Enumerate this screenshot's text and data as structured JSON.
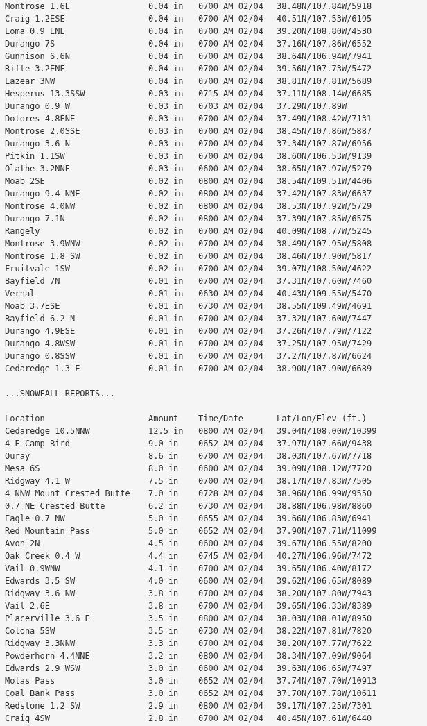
{
  "precip_rows": [
    {
      "location": "Montrose 1.6E",
      "amount": "0.04 in",
      "time": "0700 AM 02/04",
      "latlon": "38.48N/107.84W/5918"
    },
    {
      "location": "Craig 1.2ESE",
      "amount": "0.04 in",
      "time": "0700 AM 02/04",
      "latlon": "40.51N/107.53W/6195"
    },
    {
      "location": "Loma 0.9 ENE",
      "amount": "0.04 in",
      "time": "0700 AM 02/04",
      "latlon": "39.20N/108.80W/4530"
    },
    {
      "location": "Durango 7S",
      "amount": "0.04 in",
      "time": "0700 AM 02/04",
      "latlon": "37.16N/107.86W/6552"
    },
    {
      "location": "Gunnison 6.6N",
      "amount": "0.04 in",
      "time": "0700 AM 02/04",
      "latlon": "38.64N/106.94W/7941"
    },
    {
      "location": "Rifle 3.2ENE",
      "amount": "0.04 in",
      "time": "0700 AM 02/04",
      "latlon": "39.56N/107.73W/5472"
    },
    {
      "location": "Lazear 3NW",
      "amount": "0.04 in",
      "time": "0700 AM 02/04",
      "latlon": "38.81N/107.81W/5689"
    },
    {
      "location": "Hesperus 13.3SSW",
      "amount": "0.03 in",
      "time": "0715 AM 02/04",
      "latlon": "37.11N/108.14W/6685"
    },
    {
      "location": "Durango 0.9 W",
      "amount": "0.03 in",
      "time": "0703 AM 02/04",
      "latlon": "37.29N/107.89W"
    },
    {
      "location": "Dolores 4.8ENE",
      "amount": "0.03 in",
      "time": "0700 AM 02/04",
      "latlon": "37.49N/108.42W/7131"
    },
    {
      "location": "Montrose 2.0SSE",
      "amount": "0.03 in",
      "time": "0700 AM 02/04",
      "latlon": "38.45N/107.86W/5887"
    },
    {
      "location": "Durango 3.6 N",
      "amount": "0.03 in",
      "time": "0700 AM 02/04",
      "latlon": "37.34N/107.87W/6956"
    },
    {
      "location": "Pitkin 1.1SW",
      "amount": "0.03 in",
      "time": "0700 AM 02/04",
      "latlon": "38.60N/106.53W/9139"
    },
    {
      "location": "Olathe 3.2NNE",
      "amount": "0.03 in",
      "time": "0600 AM 02/04",
      "latlon": "38.65N/107.97W/5279"
    },
    {
      "location": "Moab 2SE",
      "amount": "0.02 in",
      "time": "0800 AM 02/04",
      "latlon": "38.54N/109.51W/4406"
    },
    {
      "location": "Durango 9.4 NNE",
      "amount": "0.02 in",
      "time": "0800 AM 02/04",
      "latlon": "37.42N/107.83W/6637"
    },
    {
      "location": "Montrose 4.0NW",
      "amount": "0.02 in",
      "time": "0800 AM 02/04",
      "latlon": "38.53N/107.92W/5729"
    },
    {
      "location": "Durango 7.1N",
      "amount": "0.02 in",
      "time": "0800 AM 02/04",
      "latlon": "37.39N/107.85W/6575"
    },
    {
      "location": "Rangely",
      "amount": "0.02 in",
      "time": "0700 AM 02/04",
      "latlon": "40.09N/108.77W/5245"
    },
    {
      "location": "Montrose 3.9WNW",
      "amount": "0.02 in",
      "time": "0700 AM 02/04",
      "latlon": "38.49N/107.95W/5808"
    },
    {
      "location": "Montrose 1.8 SW",
      "amount": "0.02 in",
      "time": "0700 AM 02/04",
      "latlon": "38.46N/107.90W/5817"
    },
    {
      "location": "Fruitvale 1SW",
      "amount": "0.02 in",
      "time": "0700 AM 02/04",
      "latlon": "39.07N/108.50W/4622"
    },
    {
      "location": "Bayfield 7N",
      "amount": "0.01 in",
      "time": "0700 AM 02/04",
      "latlon": "37.31N/107.60W/7460"
    },
    {
      "location": "Vernal",
      "amount": "0.01 in",
      "time": "0630 AM 02/04",
      "latlon": "40.43N/109.55W/5470"
    },
    {
      "location": "Moab 3.7ESE",
      "amount": "0.01 in",
      "time": "0730 AM 02/04",
      "latlon": "38.55N/109.49W/4691"
    },
    {
      "location": "Bayfield 6.2 N",
      "amount": "0.01 in",
      "time": "0700 AM 02/04",
      "latlon": "37.32N/107.60W/7447"
    },
    {
      "location": "Durango 4.9ESE",
      "amount": "0.01 in",
      "time": "0700 AM 02/04",
      "latlon": "37.26N/107.79W/7122"
    },
    {
      "location": "Durango 4.8WSW",
      "amount": "0.01 in",
      "time": "0700 AM 02/04",
      "latlon": "37.25N/107.95W/7429"
    },
    {
      "location": "Durango 0.8SSW",
      "amount": "0.01 in",
      "time": "0700 AM 02/04",
      "latlon": "37.27N/107.87W/6624"
    },
    {
      "location": "Cedaredge 1.3 E",
      "amount": "0.01 in",
      "time": "0700 AM 02/04",
      "latlon": "38.90N/107.90W/6689"
    }
  ],
  "snowfall": {
    "heading": "...SNOWFALL REPORTS...",
    "columns": {
      "location": "Location",
      "amount": "Amount",
      "time": "Time/Date",
      "latlon": "Lat/Lon/Elev (ft.)"
    },
    "rows": [
      {
        "location": "Cedaredge 10.5NNW",
        "amount": "12.5 in",
        "time": "0800 AM 02/04",
        "latlon": "39.04N/108.00W/10399"
      },
      {
        "location": "4 E Camp Bird",
        "amount": "9.0 in",
        "time": "0652 AM 02/04",
        "latlon": "37.97N/107.66W/9438"
      },
      {
        "location": "Ouray",
        "amount": "8.6 in",
        "time": "0700 AM 02/04",
        "latlon": "38.03N/107.67W/7718"
      },
      {
        "location": "Mesa 6S",
        "amount": "8.0 in",
        "time": "0600 AM 02/04",
        "latlon": "39.09N/108.12W/7720"
      },
      {
        "location": "Ridgway 4.1 W",
        "amount": "7.5 in",
        "time": "0700 AM 02/04",
        "latlon": "38.17N/107.83W/7505"
      },
      {
        "location": "4 NNW Mount Crested Butte",
        "amount": "7.0 in",
        "time": "0728 AM 02/04",
        "latlon": "38.96N/106.99W/9550"
      },
      {
        "location": "0.7 NE Crested Butte",
        "amount": "6.2 in",
        "time": "0730 AM 02/04",
        "latlon": "38.88N/106.98W/8860"
      },
      {
        "location": "Eagle 0.7 NW",
        "amount": "5.0 in",
        "time": "0655 AM 02/04",
        "latlon": "39.66N/106.83W/6941"
      },
      {
        "location": "Red Mountain Pass",
        "amount": "5.0 in",
        "time": "0652 AM 02/04",
        "latlon": "37.90N/107.71W/11099"
      },
      {
        "location": "Avon 2N",
        "amount": "4.5 in",
        "time": "0600 AM 02/04",
        "latlon": "39.67N/106.55W/8200"
      },
      {
        "location": "Oak Creek 0.4 W",
        "amount": "4.4 in",
        "time": "0745 AM 02/04",
        "latlon": "40.27N/106.96W/7472"
      },
      {
        "location": "Vail 0.9WNW",
        "amount": "4.1 in",
        "time": "0700 AM 02/04",
        "latlon": "39.65N/106.40W/8172"
      },
      {
        "location": "Edwards 3.5 SW",
        "amount": "4.0 in",
        "time": "0600 AM 02/04",
        "latlon": "39.62N/106.65W/8089"
      },
      {
        "location": "Ridgway 3.6 NW",
        "amount": "3.8 in",
        "time": "0700 AM 02/04",
        "latlon": "38.20N/107.80W/7943"
      },
      {
        "location": "Vail 2.6E",
        "amount": "3.8 in",
        "time": "0700 AM 02/04",
        "latlon": "39.65N/106.33W/8389"
      },
      {
        "location": "Placerville 3.6 E",
        "amount": "3.5 in",
        "time": "0800 AM 02/04",
        "latlon": "38.03N/108.01W/8950"
      },
      {
        "location": "Colona 5SW",
        "amount": "3.5 in",
        "time": "0730 AM 02/04",
        "latlon": "38.22N/107.81W/7820"
      },
      {
        "location": "Ridgway 3.3NNW",
        "amount": "3.3 in",
        "time": "0700 AM 02/04",
        "latlon": "38.20N/107.77W/7622"
      },
      {
        "location": "Powderhorn 4.4NNE",
        "amount": "3.2 in",
        "time": "0800 AM 02/04",
        "latlon": "38.34N/107.09W/9064"
      },
      {
        "location": "Edwards 2.9 WSW",
        "amount": "3.0 in",
        "time": "0600 AM 02/04",
        "latlon": "39.63N/106.65W/7497"
      },
      {
        "location": "Molas Pass",
        "amount": "3.0 in",
        "time": "0652 AM 02/04",
        "latlon": "37.74N/107.70W/10913"
      },
      {
        "location": "Coal Bank Pass",
        "amount": "3.0 in",
        "time": "0652 AM 02/04",
        "latlon": "37.70N/107.78W/10611"
      },
      {
        "location": "Redstone 1.2 SW",
        "amount": "2.9 in",
        "time": "0800 AM 02/04",
        "latlon": "39.17N/107.25W/7301"
      },
      {
        "location": "Craig 4SW",
        "amount": "2.8 in",
        "time": "0700 AM 02/04",
        "latlon": "40.45N/107.61W/6440"
      }
    ]
  }
}
